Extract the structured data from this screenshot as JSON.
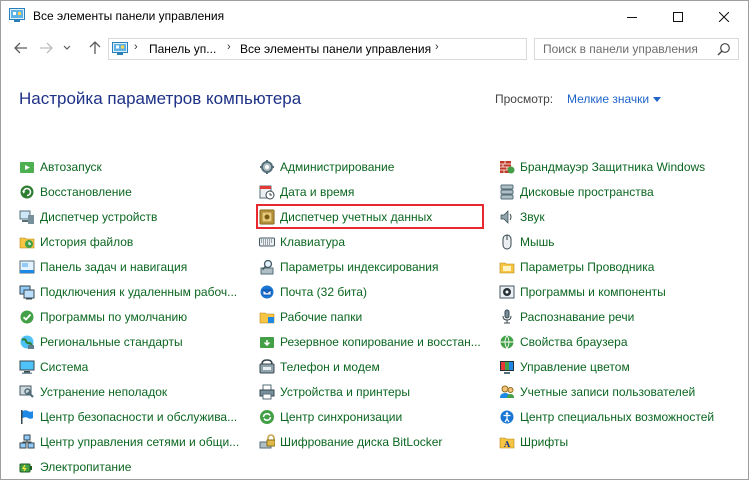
{
  "window": {
    "title": "Все элементы панели управления"
  },
  "address": {
    "crumbs": [
      "Панель уп...",
      "Все элементы панели управления"
    ]
  },
  "search": {
    "placeholder": "Поиск в панели управления"
  },
  "header": {
    "title": "Настройка параметров компьютера",
    "view_label": "Просмотр:",
    "view_value": "Мелкие значки"
  },
  "highlight_color": "#e8282e",
  "columns": [
    [
      {
        "label": "Автозапуск",
        "icon": "autoplay-icon"
      },
      {
        "label": "Восстановление",
        "icon": "recovery-icon"
      },
      {
        "label": "Диспетчер устройств",
        "icon": "device-manager-icon"
      },
      {
        "label": "История файлов",
        "icon": "file-history-icon"
      },
      {
        "label": "Панель задач и навигация",
        "icon": "taskbar-icon"
      },
      {
        "label": "Подключения к удаленным рабоч...",
        "icon": "remote-desktop-icon"
      },
      {
        "label": "Программы по умолчанию",
        "icon": "default-programs-icon"
      },
      {
        "label": "Региональные стандарты",
        "icon": "region-icon"
      },
      {
        "label": "Система",
        "icon": "system-icon"
      },
      {
        "label": "Устранение неполадок",
        "icon": "troubleshoot-icon"
      },
      {
        "label": "Центр безопасности и обслужива...",
        "icon": "flag-icon"
      },
      {
        "label": "Центр управления сетями и общи...",
        "icon": "network-icon"
      },
      {
        "label": "Электропитание",
        "icon": "power-icon"
      }
    ],
    [
      {
        "label": "Администрирование",
        "icon": "admin-tools-icon"
      },
      {
        "label": "Дата и время",
        "icon": "clock-icon"
      },
      {
        "label": "Диспетчер учетных данных",
        "icon": "credential-vault-icon",
        "highlighted": true
      },
      {
        "label": "Клавиатура",
        "icon": "keyboard-icon"
      },
      {
        "label": "Параметры индексирования",
        "icon": "indexing-icon"
      },
      {
        "label": "Почта (32 бита)",
        "icon": "mail-icon"
      },
      {
        "label": "Рабочие папки",
        "icon": "work-folders-icon"
      },
      {
        "label": "Резервное копирование и восстан...",
        "icon": "backup-icon"
      },
      {
        "label": "Телефон и модем",
        "icon": "phone-icon"
      },
      {
        "label": "Устройства и принтеры",
        "icon": "printer-icon"
      },
      {
        "label": "Центр синхронизации",
        "icon": "sync-icon"
      },
      {
        "label": "Шифрование диска BitLocker",
        "icon": "bitlocker-icon"
      }
    ],
    [
      {
        "label": "Брандмауэр Защитника Windows",
        "icon": "firewall-icon"
      },
      {
        "label": "Дисковые пространства",
        "icon": "storage-spaces-icon"
      },
      {
        "label": "Звук",
        "icon": "speaker-icon"
      },
      {
        "label": "Мышь",
        "icon": "mouse-icon"
      },
      {
        "label": "Параметры Проводника",
        "icon": "explorer-options-icon"
      },
      {
        "label": "Программы и компоненты",
        "icon": "programs-icon"
      },
      {
        "label": "Распознавание речи",
        "icon": "microphone-icon"
      },
      {
        "label": "Свойства браузера",
        "icon": "internet-options-icon"
      },
      {
        "label": "Управление цветом",
        "icon": "color-management-icon"
      },
      {
        "label": "Учетные записи пользователей",
        "icon": "user-accounts-icon"
      },
      {
        "label": "Центр специальных возможностей",
        "icon": "accessibility-icon"
      },
      {
        "label": "Шрифты",
        "icon": "fonts-icon"
      }
    ]
  ]
}
